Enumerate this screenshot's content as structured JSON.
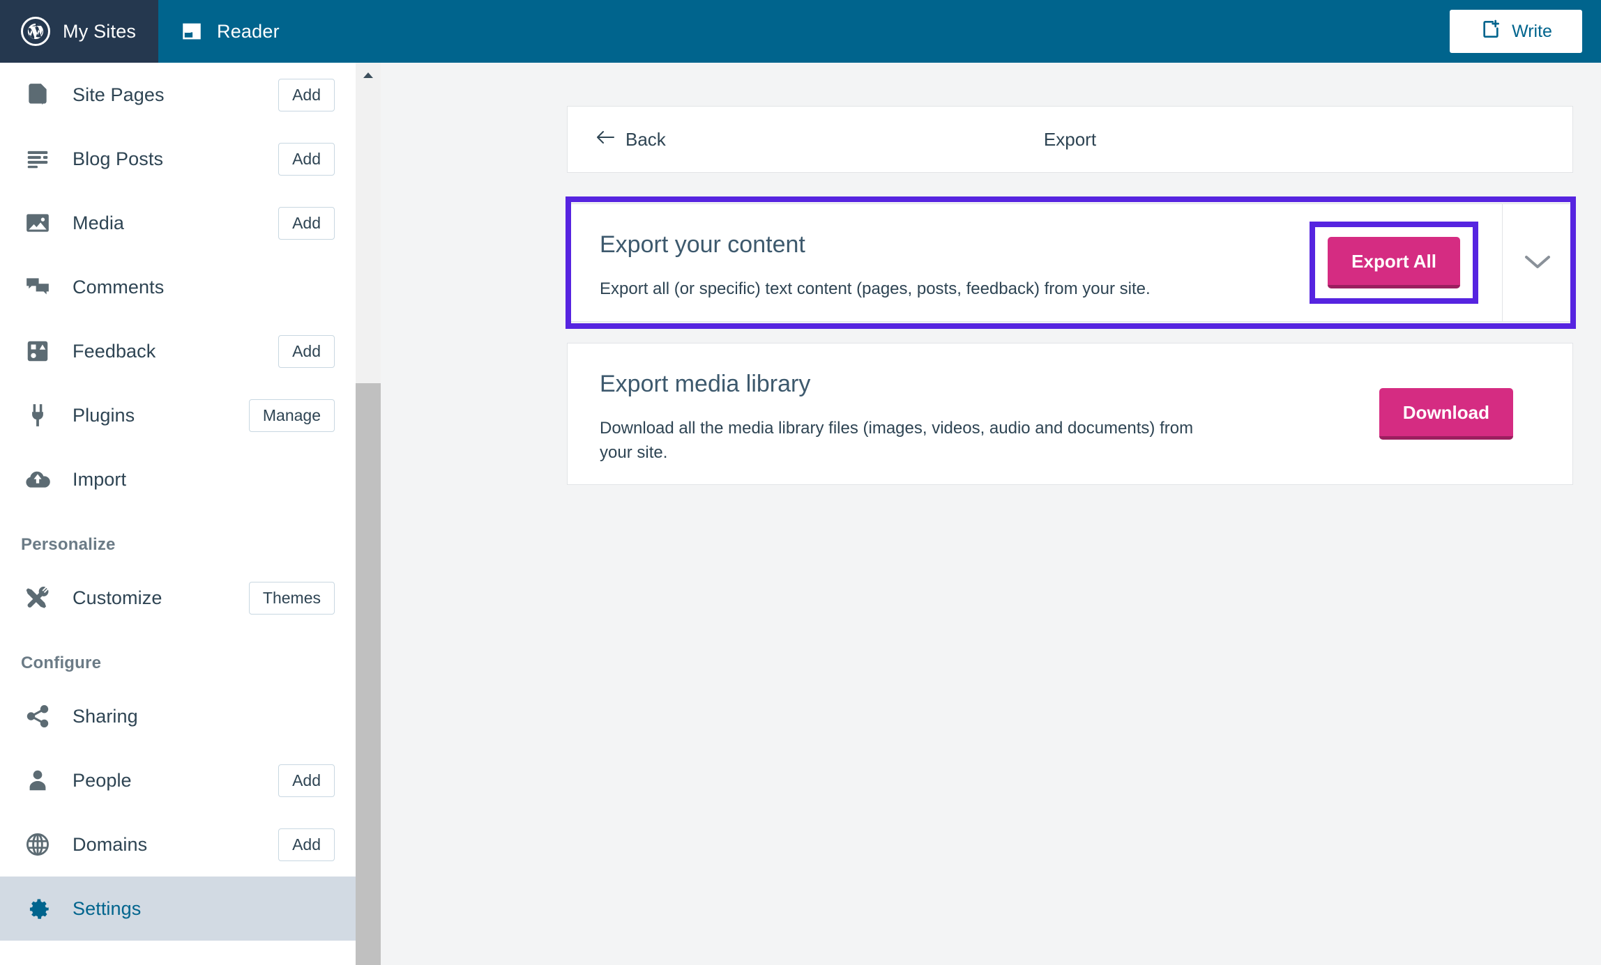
{
  "masthead": {
    "my_sites_label": "My Sites",
    "my_sites_icon": "wordpress-logo-icon",
    "reader_label": "Reader",
    "reader_icon": "reader-icon",
    "write_label": "Write",
    "write_icon": "write-page-plus-icon",
    "colors": {
      "my_sites_bg": "#25384f",
      "bar_bg": "#00648d",
      "write_text": "#00648d"
    }
  },
  "sidebar": {
    "items": [
      {
        "label": "Site Pages",
        "icon": "page-icon",
        "action": "Add",
        "selected": false
      },
      {
        "label": "Blog Posts",
        "icon": "posts-list-icon",
        "action": "Add",
        "selected": false
      },
      {
        "label": "Media",
        "icon": "image-icon",
        "action": "Add",
        "selected": false
      },
      {
        "label": "Comments",
        "icon": "comments-bubbles-icon",
        "action": "",
        "selected": false
      },
      {
        "label": "Feedback",
        "icon": "feedback-shapes-icon",
        "action": "Add",
        "selected": false
      },
      {
        "label": "Plugins",
        "icon": "plug-icon",
        "action": "Manage",
        "selected": false
      },
      {
        "label": "Import",
        "icon": "cloud-upload-icon",
        "action": "",
        "selected": false
      }
    ],
    "heading_personalize": "Personalize",
    "personalize_items": [
      {
        "label": "Customize",
        "icon": "tools-icon",
        "action": "Themes",
        "selected": false
      }
    ],
    "heading_configure": "Configure",
    "configure_items": [
      {
        "label": "Sharing",
        "icon": "share-icon",
        "action": "",
        "selected": false
      },
      {
        "label": "People",
        "icon": "person-icon",
        "action": "Add",
        "selected": false
      },
      {
        "label": "Domains",
        "icon": "globe-icon",
        "action": "Add",
        "selected": false
      },
      {
        "label": "Settings",
        "icon": "gear-icon",
        "action": "",
        "selected": true
      }
    ],
    "scrollbar": {
      "up_icon": "scroll-up-arrow-icon"
    },
    "colors": {
      "selected_bg": "#d2dae3",
      "selected_text": "#00648d",
      "label_text": "#2e4453"
    }
  },
  "main": {
    "header": {
      "back_label": "Back",
      "back_icon": "arrow-left-icon",
      "title": "Export"
    },
    "export_content_card": {
      "title": "Export your content",
      "description": "Export all (or specific) text content (pages, posts, feedback) from your site.",
      "button_label": "Export All",
      "chevron_icon": "chevron-down-icon",
      "highlighted": true
    },
    "export_media_card": {
      "title": "Export media library",
      "description": "Download all the media library files (images, videos, audio and documents) from your site.",
      "button_label": "Download"
    },
    "colors": {
      "page_bg": "#f3f4f5",
      "card_bg": "#ffffff",
      "card_border": "#e2e4e7",
      "button_pink": "#d52c82",
      "button_pink_shadow": "#9b1f5f",
      "highlight_purple": "#5624e0",
      "title_text": "#3d596d"
    }
  }
}
